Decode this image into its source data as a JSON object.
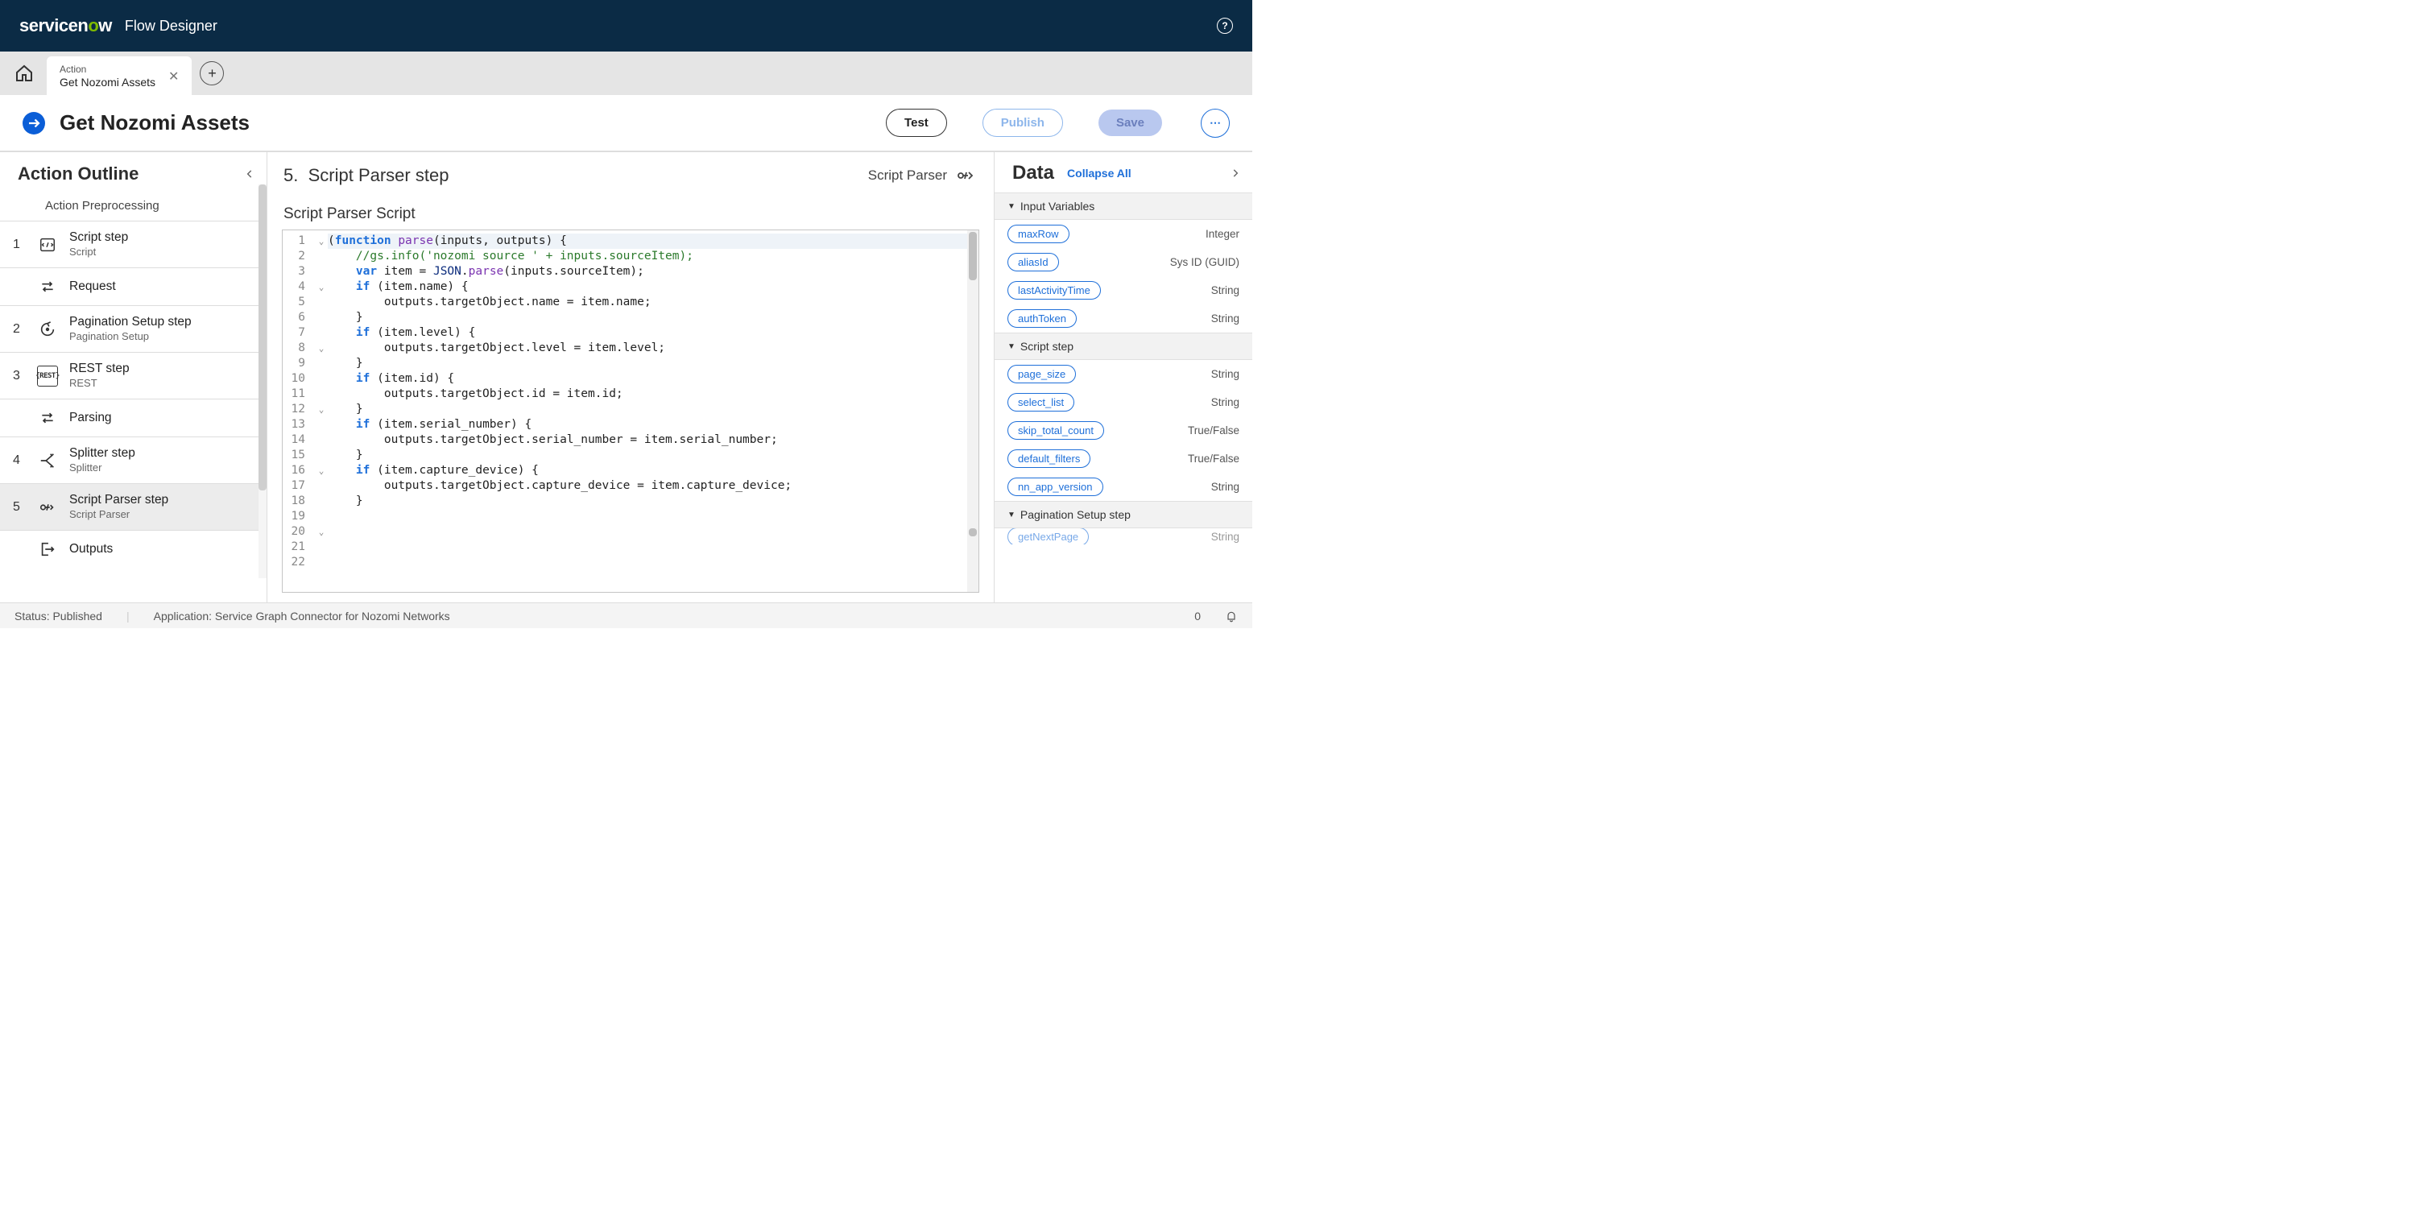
{
  "topbar": {
    "brand_prefix": "service",
    "brand_n": "n",
    "brand_o": "o",
    "brand_w": "w",
    "appname": "Flow Designer"
  },
  "tab": {
    "type": "Action",
    "title": "Get Nozomi Assets"
  },
  "page_title": "Get Nozomi Assets",
  "buttons": {
    "test": "Test",
    "publish": "Publish",
    "save": "Save"
  },
  "outline": {
    "header": "Action Outline",
    "truncated": "Action Preprocessing",
    "steps": [
      {
        "num": "1",
        "title": "Script step",
        "sub": "Script",
        "icon": "script"
      },
      {
        "num": "",
        "title": "Request",
        "sub": "",
        "icon": "swap"
      },
      {
        "num": "2",
        "title": "Pagination Setup step",
        "sub": "Pagination Setup",
        "icon": "cycle"
      },
      {
        "num": "3",
        "title": "REST step",
        "sub": "REST",
        "icon": "rest"
      },
      {
        "num": "",
        "title": "Parsing",
        "sub": "",
        "icon": "swap"
      },
      {
        "num": "4",
        "title": "Splitter step",
        "sub": "Splitter",
        "icon": "split"
      },
      {
        "num": "5",
        "title": "Script Parser step",
        "sub": "Script Parser",
        "icon": "parser"
      }
    ],
    "outputs": "Outputs"
  },
  "editor": {
    "number": "5.",
    "title": "Script Parser step",
    "type": "Script Parser",
    "script_label": "Script Parser Script"
  },
  "code_lines": [
    "(function parse(inputs, outputs) {",
    "    //gs.info('nozomi source ' + inputs.sourceItem);",
    "    var item = JSON.parse(inputs.sourceItem);",
    "    if (item.name) {",
    "        outputs.targetObject.name = item.name;",
    "    }",
    "",
    "    if (item.level) {",
    "        outputs.targetObject.level = item.level;",
    "    }",
    "",
    "    if (item.id) {",
    "        outputs.targetObject.id = item.id;",
    "    }",
    "",
    "    if (item.serial_number) {",
    "        outputs.targetObject.serial_number = item.serial_number;",
    "    }",
    "",
    "    if (item.capture_device) {",
    "        outputs.targetObject.capture_device = item.capture_device;",
    "    }"
  ],
  "data_panel": {
    "title": "Data",
    "collapse": "Collapse All",
    "sections": [
      {
        "title": "Input Variables",
        "vars": [
          {
            "name": "maxRow",
            "type": "Integer"
          },
          {
            "name": "aliasId",
            "type": "Sys ID (GUID)"
          },
          {
            "name": "lastActivityTime",
            "type": "String"
          },
          {
            "name": "authToken",
            "type": "String"
          }
        ]
      },
      {
        "title": "Script step",
        "vars": [
          {
            "name": "page_size",
            "type": "String"
          },
          {
            "name": "select_list",
            "type": "String"
          },
          {
            "name": "skip_total_count",
            "type": "True/False"
          },
          {
            "name": "default_filters",
            "type": "True/False"
          },
          {
            "name": "nn_app_version",
            "type": "String"
          }
        ]
      },
      {
        "title": "Pagination Setup step",
        "vars": [
          {
            "name": "getNextPage",
            "type": "String"
          }
        ]
      }
    ]
  },
  "status": {
    "published": "Status: Published",
    "application": "Application: Service Graph Connector for Nozomi Networks",
    "count": "0"
  }
}
